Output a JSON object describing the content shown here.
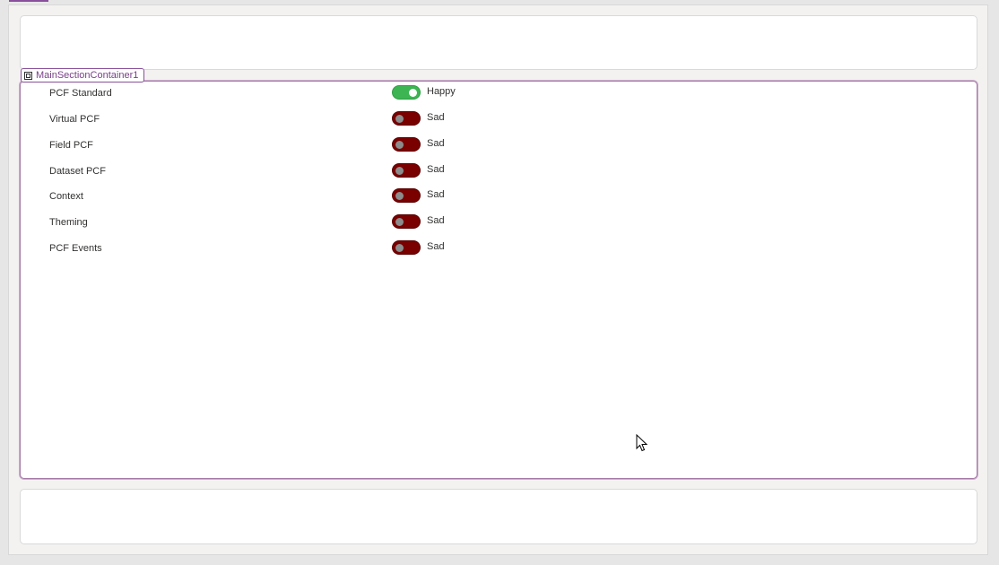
{
  "container": {
    "name": "MainSectionContainer1"
  },
  "toggles": [
    {
      "label": "PCF Standard",
      "on": true,
      "state": "Happy"
    },
    {
      "label": "Virtual PCF",
      "on": false,
      "state": "Sad"
    },
    {
      "label": "Field PCF",
      "on": false,
      "state": "Sad"
    },
    {
      "label": "Dataset PCF",
      "on": false,
      "state": "Sad"
    },
    {
      "label": "Context",
      "on": false,
      "state": "Sad"
    },
    {
      "label": "Theming",
      "on": false,
      "state": "Sad"
    },
    {
      "label": "PCF Events",
      "on": false,
      "state": "Sad"
    }
  ],
  "colors": {
    "toggle_on": "#3cb552",
    "toggle_off": "#7a0000",
    "selection_accent": "#8a4f9c"
  }
}
